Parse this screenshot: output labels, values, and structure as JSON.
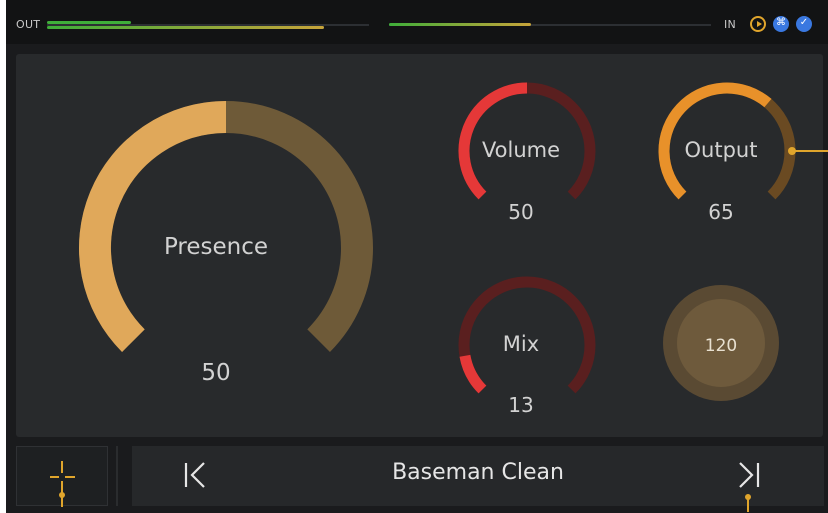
{
  "meters": {
    "out_label": "OUT",
    "in_label": "IN",
    "out_level_a": 0.26,
    "out_level_b": 0.86,
    "in_level": 0.44,
    "colors": {
      "green": "#3fae3a",
      "amber": "#c7a43a",
      "track": "#2c2f33"
    }
  },
  "status_icons": [
    "play-icon",
    "usb-icon",
    "bluetooth-icon"
  ],
  "knobs": {
    "presence": {
      "label": "Presence",
      "value": "50",
      "level": 0.5,
      "color": "#e0a85a",
      "track": "#6e5a38"
    },
    "volume": {
      "label": "Volume",
      "value": "50",
      "level": 0.5,
      "color": "#e53838",
      "track": "#5a1f1f"
    },
    "output": {
      "label": "Output",
      "value": "65",
      "level": 0.65,
      "color": "#e8912a",
      "track": "#6a4a22"
    },
    "mix": {
      "label": "Mix",
      "value": "13",
      "level": 0.13,
      "color": "#e53838",
      "track": "#5a1f1f"
    }
  },
  "tap_button": {
    "label": "120"
  },
  "preset": {
    "name": "Baseman Clean",
    "prev_icon": "skip-previous-icon",
    "next_icon": "skip-next-icon"
  },
  "tuner_icon": "crosshair-icon",
  "accent": "#e0a52c"
}
